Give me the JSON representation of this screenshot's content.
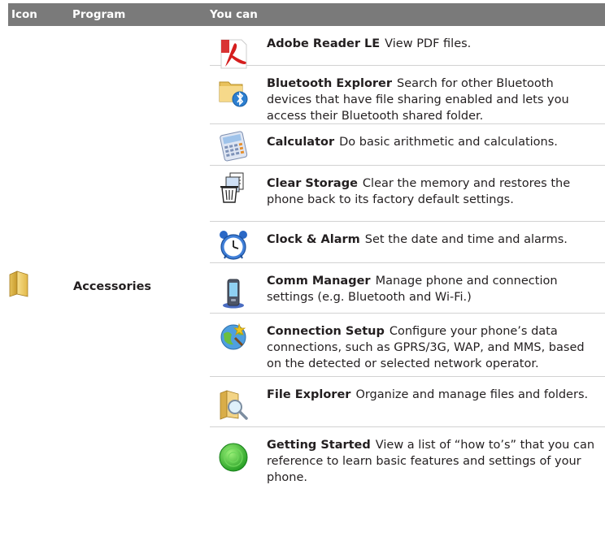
{
  "columns": {
    "icon": "Icon",
    "program": "Program",
    "you_can": "You can"
  },
  "category": {
    "name": "Accessories",
    "icon": "folder-icon"
  },
  "programs": [
    {
      "name": "Adobe Reader LE",
      "desc": "View PDF files.",
      "icon": "adobe-reader-icon"
    },
    {
      "name": "Bluetooth Explorer",
      "desc": "Search for other Bluetooth devices that have file sharing enabled and lets you access their Bluetooth shared folder.",
      "icon": "bluetooth-explorer-icon"
    },
    {
      "name": "Calculator",
      "desc": "Do basic arithmetic and calculations.",
      "icon": "calculator-icon"
    },
    {
      "name": "Clear Storage",
      "desc": "Clear the memory and restores the phone back to its factory default settings.",
      "icon": "clear-storage-icon"
    },
    {
      "name": "Clock & Alarm",
      "desc": "Set the date and time and alarms.",
      "icon": "clock-alarm-icon"
    },
    {
      "name": "Comm Manager",
      "desc": "Manage phone and connection settings (e.g. Bluetooth and Wi-Fi.)",
      "icon": "comm-manager-icon"
    },
    {
      "name": "Connection Setup",
      "desc": "Configure your phone’s data connections, such as GPRS/3G, WAP, and MMS, based on the detected or selected network operator.",
      "icon": "connection-setup-icon"
    },
    {
      "name": "File Explorer",
      "desc": "Organize and manage files and folders.",
      "icon": "file-explorer-icon"
    },
    {
      "name": "Getting Started",
      "desc": "View a list of “how to’s” that you can reference to learn basic features and settings of your phone.",
      "icon": "getting-started-icon"
    }
  ]
}
